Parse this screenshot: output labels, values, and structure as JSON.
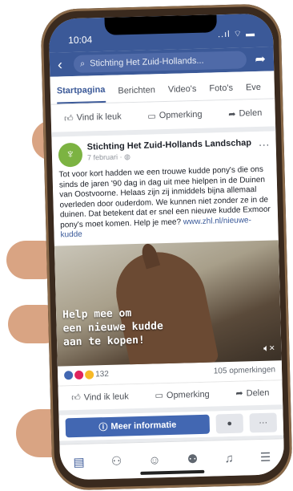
{
  "status": {
    "time": "10:04",
    "system": "..ıl ⌔ ▬"
  },
  "navbar": {
    "search_text": "Stichting Het Zuid-Hollands..."
  },
  "tabs": [
    {
      "label": "Startpagina",
      "active": true
    },
    {
      "label": "Berichten"
    },
    {
      "label": "Video's"
    },
    {
      "label": "Foto's"
    },
    {
      "label": "Eve"
    }
  ],
  "top_actions": {
    "like": "Vind ik leuk",
    "comment": "Opmerking",
    "share": "Delen"
  },
  "post": {
    "page_name": "Stichting Het Zuid-Hollands Landschap",
    "date": "7 februari · ",
    "text": "Tot voor kort hadden we een trouwe kudde pony's die ons sinds de jaren '90 dag in dag uit mee hielpen in de Duinen van Oostvoorne. Helaas zijn zij inmiddels bijna allemaal overleden door ouderdom. We kunnen niet zonder ze in de duinen. Dat betekent dat er snel een nieuwe kudde Exmoor pony's moet komen. Help je mee? ",
    "link": "www.zhl.nl/nieuwe-kudde",
    "video_overlay": [
      "Help mee om",
      "een nieuwe kudde",
      "aan te kopen!"
    ],
    "reaction_count": "132",
    "comments_count": "105 opmerkingen"
  },
  "bottom_actions": {
    "like": "Vind ik leuk",
    "comment": "Opmerking",
    "share": "Delen"
  },
  "cta": {
    "label": "Meer informatie",
    "more": "···"
  },
  "colors": {
    "facebook_blue": "#3b5998",
    "cta_blue": "#4267b2",
    "avatar_green": "#7cb342"
  },
  "icons": [
    "back-arrow-icon",
    "search-icon",
    "share-arrow-icon",
    "thumbs-up-icon",
    "comment-icon",
    "share-icon",
    "more-dots-icon",
    "globe-icon",
    "mute-icon",
    "info-icon",
    "messenger-icon",
    "news-feed-icon",
    "friends-icon",
    "profile-icon",
    "groups-icon",
    "bell-icon",
    "menu-icon"
  ]
}
